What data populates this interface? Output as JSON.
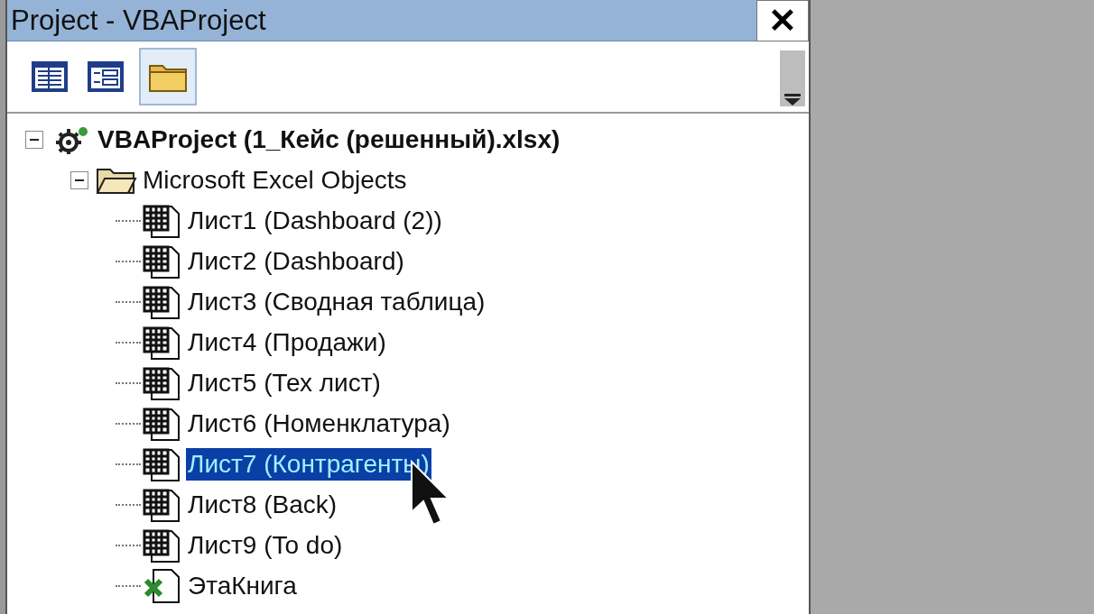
{
  "window": {
    "title": "Project - VBAProject",
    "close": "✕"
  },
  "toolbar": [
    {
      "kind": "view-code",
      "selected": false
    },
    {
      "kind": "view-object",
      "selected": false
    },
    {
      "kind": "toggle-folders",
      "selected": true
    }
  ],
  "tree": [
    {
      "kind": "project",
      "label": "VBAProject (1_Кейс (решенный).xlsx)",
      "expanded": true,
      "selected": false,
      "children": [
        {
          "kind": "folder",
          "label": "Microsoft Excel Objects",
          "expanded": true,
          "selected": false,
          "children": [
            {
              "kind": "sheet",
              "label": "Лист1 (Dashboard (2))",
              "selected": false
            },
            {
              "kind": "sheet",
              "label": "Лист2 (Dashboard)",
              "selected": false
            },
            {
              "kind": "sheet",
              "label": "Лист3 (Сводная таблица)",
              "selected": false
            },
            {
              "kind": "sheet",
              "label": "Лист4 (Продажи)",
              "selected": false
            },
            {
              "kind": "sheet",
              "label": "Лист5 (Тех лист)",
              "selected": false
            },
            {
              "kind": "sheet",
              "label": "Лист6 (Номенклатура)",
              "selected": false
            },
            {
              "kind": "sheet",
              "label": "Лист7 (Контрагенты)",
              "selected": true
            },
            {
              "kind": "sheet",
              "label": "Лист8 (Back)",
              "selected": false
            },
            {
              "kind": "sheet",
              "label": "Лист9 (To do)",
              "selected": false
            },
            {
              "kind": "workbook",
              "label": "ЭтаКнига",
              "selected": false
            }
          ]
        }
      ]
    }
  ]
}
